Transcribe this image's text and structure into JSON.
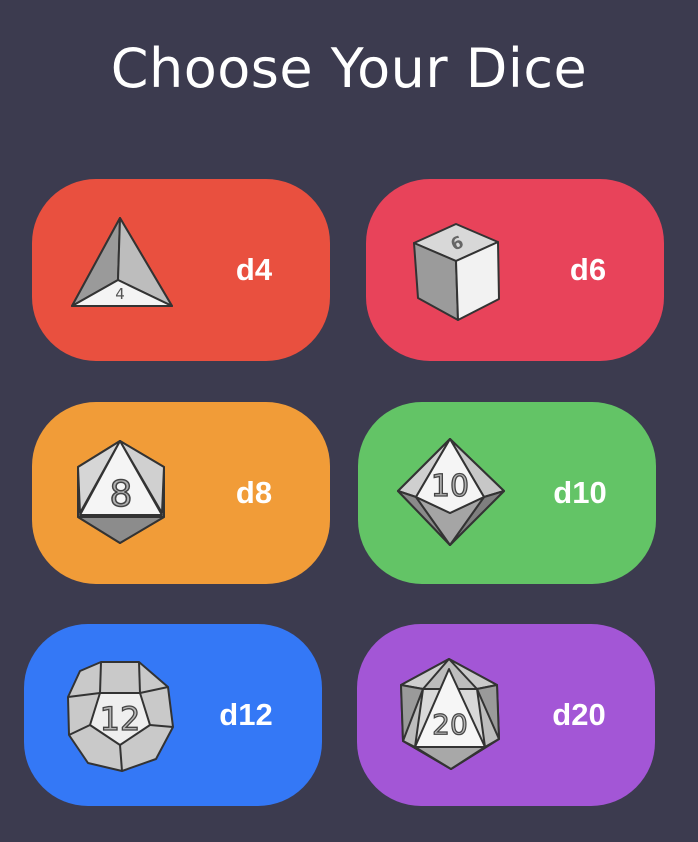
{
  "title": "Choose Your Dice",
  "dice": [
    {
      "label": "d4",
      "face": "4",
      "color": "#e9503f",
      "icon": "d4-die-icon"
    },
    {
      "label": "d6",
      "face": "6",
      "color": "#e8435a",
      "icon": "d6-die-icon"
    },
    {
      "label": "d8",
      "face": "8",
      "color": "#f19c38",
      "icon": "d8-die-icon"
    },
    {
      "label": "d10",
      "face": "10",
      "color": "#63c466",
      "icon": "d10-die-icon"
    },
    {
      "label": "d12",
      "face": "12",
      "color": "#3478f6",
      "icon": "d12-die-icon"
    },
    {
      "label": "d20",
      "face": "20",
      "color": "#a356d6",
      "icon": "d20-die-icon"
    }
  ]
}
